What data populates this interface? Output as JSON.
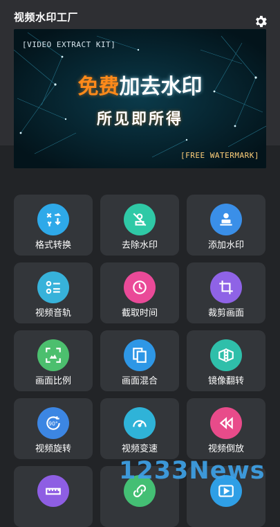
{
  "app": {
    "title": "视频水印工厂",
    "settings_icon": "gear-icon"
  },
  "banner": {
    "tag_top": "[VIDEO EXTRACT KIT]",
    "headline_part1": "免费",
    "headline_part2": "加去水印",
    "subline": "所见即所得",
    "tag_bottom": "[FREE WATERMARK]"
  },
  "tools": [
    {
      "label": "格式转换",
      "icon": "format-convert-icon",
      "color": "#2ea9e9"
    },
    {
      "label": "去除水印",
      "icon": "remove-watermark-icon",
      "color": "#2fc9a6"
    },
    {
      "label": "添加水印",
      "icon": "add-watermark-icon",
      "color": "#3a8fe8"
    },
    {
      "label": "视频音轨",
      "icon": "audio-track-icon",
      "color": "#37b2da"
    },
    {
      "label": "截取时间",
      "icon": "clock-icon",
      "color": "#ea4a98"
    },
    {
      "label": "裁剪画面",
      "icon": "crop-icon",
      "color": "#8f63e6"
    },
    {
      "label": "画面比例",
      "icon": "aspect-ratio-icon",
      "color": "#4cbf6e"
    },
    {
      "label": "画面混合",
      "icon": "layers-icon",
      "color": "#2e97e6"
    },
    {
      "label": "镜像翻转",
      "icon": "mirror-flip-icon",
      "color": "#2fbfaa"
    },
    {
      "label": "视频旋转",
      "icon": "rotate-90-icon",
      "color": "#3c86e3"
    },
    {
      "label": "视频变速",
      "icon": "speedometer-icon",
      "color": "#2fb3d8"
    },
    {
      "label": "视频倒放",
      "icon": "rewind-icon",
      "color": "#e84b8a"
    },
    {
      "label": "",
      "icon": "ruler-icon",
      "color": "#8e5ee3"
    },
    {
      "label": "",
      "icon": "link-icon",
      "color": "#44bf74"
    },
    {
      "label": "",
      "icon": "video-play-icon",
      "color": "#2f9fe6"
    }
  ],
  "watermark": {
    "text": "1233News"
  }
}
